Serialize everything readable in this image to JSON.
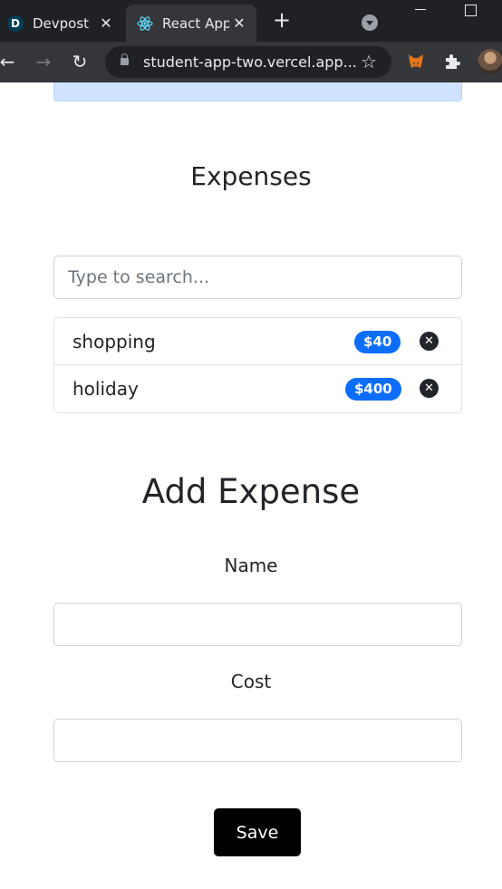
{
  "browser": {
    "tabs": [
      {
        "title": "Devpost",
        "favicon": "devpost-icon",
        "favicon_letter": "D",
        "active": false
      },
      {
        "title": "React App",
        "favicon": "react-icon",
        "active": true
      }
    ],
    "close_glyph": "✕",
    "new_tab_glyph": "+",
    "url": "student-app-two.vercel.app...",
    "icons": [
      "back-icon",
      "forward-icon",
      "reload-icon",
      "lock-icon",
      "star-icon",
      "metamask-icon",
      "puzzle-icon",
      "avatar"
    ],
    "glyphs": {
      "back": "←",
      "forward": "→",
      "reload": "↻",
      "star": "☆"
    }
  },
  "expenses": {
    "title": "Expenses",
    "search": {
      "placeholder": "Type to search...",
      "value": ""
    },
    "items": [
      {
        "name": "shopping",
        "cost": "$40"
      },
      {
        "name": "holiday",
        "cost": "$400"
      }
    ],
    "delete_glyph": "✕"
  },
  "add_expense": {
    "title": "Add Expense",
    "name_label": "Name",
    "name_value": "",
    "cost_label": "Cost",
    "cost_value": "",
    "save_label": "Save"
  },
  "colors": {
    "badge": "#0d6efd",
    "alert": "#cfe2ff",
    "button": "#000000",
    "chrome_dark": "#202124",
    "chrome_toolbar": "#35363a"
  }
}
